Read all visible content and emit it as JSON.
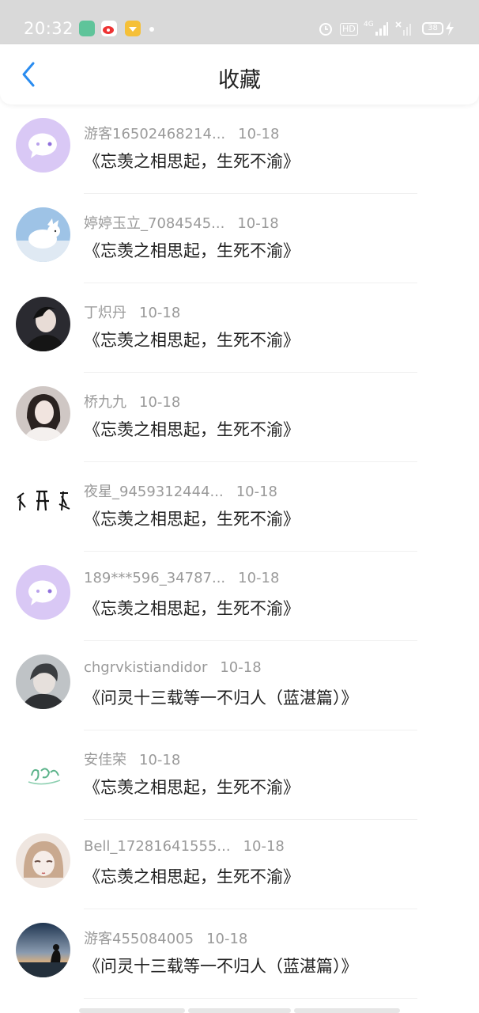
{
  "status_bar": {
    "time": "20:32",
    "hd_label": "HD",
    "network_label": "4G",
    "battery": "38"
  },
  "header": {
    "back_icon": "chevron-left-icon",
    "title": "收藏"
  },
  "colors": {
    "accent": "#2a8cf0",
    "status_bar_bg": "#d9d9d9",
    "meta_text": "#9a9a9a",
    "title_text": "#222222",
    "default_avatar_bg": "#d9c8f5"
  },
  "items": [
    {
      "user": "游客16502468214...",
      "date": "10-18",
      "title": "《忘羡之相思起，生死不渝》",
      "avatar": "default-avatar"
    },
    {
      "user": "婷婷玉立_7084545...",
      "date": "10-18",
      "title": "《忘羡之相思起，生死不渝》",
      "avatar": "white-fox-avatar"
    },
    {
      "user": "丁炽丹",
      "date": "10-18",
      "title": "《忘羡之相思起，生死不渝》",
      "avatar": "portrait-avatar"
    },
    {
      "user": "桥九九",
      "date": "10-18",
      "title": "《忘羡之相思起，生死不渝》",
      "avatar": "portrait-avatar"
    },
    {
      "user": "夜星_9459312444...",
      "date": "10-18",
      "title": "《忘羡之相思起，生死不渝》",
      "avatar": "calligraphy-avatar"
    },
    {
      "user": "189***596_34787...",
      "date": "10-18",
      "title": "《忘羡之相思起，生死不渝》",
      "avatar": "default-avatar"
    },
    {
      "user": "chgrvkistiandidor",
      "date": "10-18",
      "title": "《问灵十三载等一不归人（蓝湛篇）》",
      "avatar": "portrait-avatar"
    },
    {
      "user": "安佳荣",
      "date": "10-18",
      "title": "《忘羡之相思起，生死不渝》",
      "avatar": "doodle-avatar"
    },
    {
      "user": "Bell_17281641555...",
      "date": "10-18",
      "title": "《忘羡之相思起，生死不渝》",
      "avatar": "anime-avatar"
    },
    {
      "user": "游客455084005",
      "date": "10-18",
      "title": "《问灵十三载等一不归人（蓝湛篇）》",
      "avatar": "sunset-avatar"
    }
  ]
}
